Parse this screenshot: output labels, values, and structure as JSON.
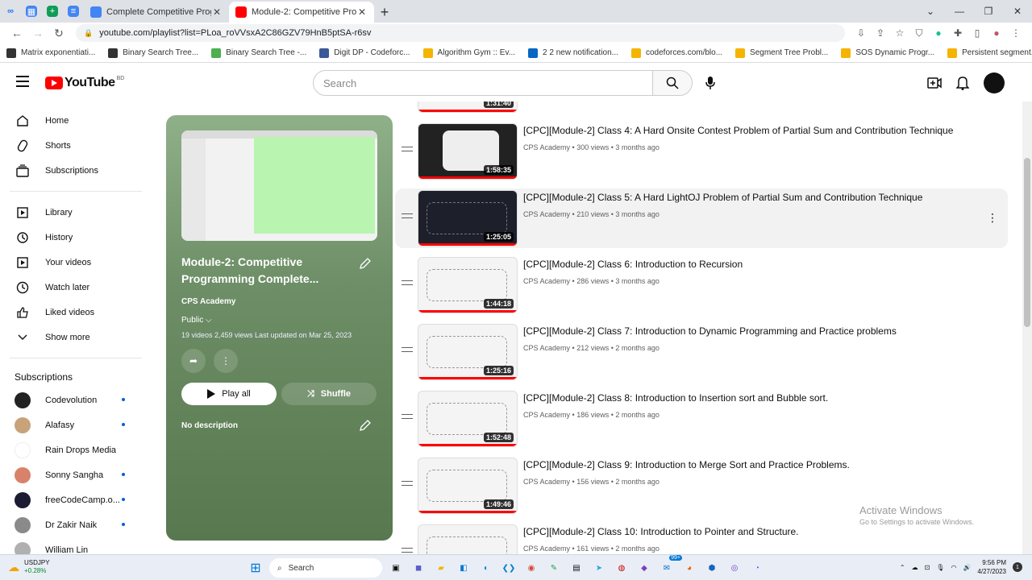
{
  "browser": {
    "tabs": [
      {
        "title": "Complete Competitive Programm",
        "active": false,
        "fav_color": "#4285f4"
      },
      {
        "title": "Module-2: Competitive Program",
        "active": true,
        "fav_color": "#ff0000"
      }
    ],
    "url": "youtube.com/playlist?list=PLoa_roVVsxA2C86GZV79HnB5ptSA-r6sv",
    "bookmarks": [
      "Matrix exponentiati...",
      "Binary Search Tree...",
      "Binary Search Tree -...",
      "Digit DP - Codeforc...",
      "Algorithm Gym :: Ev...",
      "2 2 new notification...",
      "codeforces.com/blo...",
      "Segment Tree Probl...",
      "SOS Dynamic Progr...",
      "Persistent segment..."
    ]
  },
  "youtube": {
    "logo_text": "YouTube",
    "region": "BD",
    "search_placeholder": "Search"
  },
  "sidebar": {
    "main": [
      {
        "label": "Home",
        "icon": "home-icon"
      },
      {
        "label": "Shorts",
        "icon": "shorts-icon"
      },
      {
        "label": "Subscriptions",
        "icon": "subscriptions-icon"
      }
    ],
    "library": [
      {
        "label": "Library",
        "icon": "library-icon"
      },
      {
        "label": "History",
        "icon": "history-icon"
      },
      {
        "label": "Your videos",
        "icon": "your-videos-icon"
      },
      {
        "label": "Watch later",
        "icon": "watch-later-icon"
      },
      {
        "label": "Liked videos",
        "icon": "liked-videos-icon"
      },
      {
        "label": "Show more",
        "icon": "chevron-down-icon"
      }
    ],
    "subscriptions_heading": "Subscriptions",
    "subscriptions": [
      {
        "name": "Codevolution",
        "color": "#222222",
        "dot": true
      },
      {
        "name": "Alafasy",
        "color": "#c8a27a",
        "dot": true
      },
      {
        "name": "Rain Drops Media",
        "color": "#ffffff",
        "dot": false
      },
      {
        "name": "Sonny Sangha",
        "color": "#d9826b",
        "dot": true
      },
      {
        "name": "freeCodeCamp.o...",
        "color": "#1b1b32",
        "dot": true
      },
      {
        "name": "Dr Zakir Naik",
        "color": "#8a8a8a",
        "dot": true
      },
      {
        "name": "William Lin",
        "color": "#b0b0b0",
        "dot": false
      }
    ]
  },
  "playlist": {
    "title": "Module-2: Competitive Programming Complete...",
    "channel": "CPS Academy",
    "visibility": "Public",
    "meta": "19 videos   2,459 views   Last updated on Mar 25, 2023",
    "play_all": "Play all",
    "shuffle": "Shuffle",
    "description": "No description"
  },
  "videos": [
    {
      "title": "",
      "meta": "",
      "duration": "1:31:40",
      "partial": true
    },
    {
      "title": "[CPC][Module-2] Class 4: A Hard Onsite Contest Problem of Partial Sum and Contribution Technique",
      "channel": "CPS Academy",
      "views": "300 views",
      "age": "3 months ago",
      "duration": "1:58:35"
    },
    {
      "title": "[CPC][Module-2] Class 5: A Hard LightOJ Problem of Partial Sum and Contribution Technique",
      "channel": "CPS Academy",
      "views": "210 views",
      "age": "3 months ago",
      "duration": "1:25:05",
      "hover": true
    },
    {
      "title": "[CPC][Module-2] Class 6: Introduction to Recursion",
      "channel": "CPS Academy",
      "views": "286 views",
      "age": "3 months ago",
      "duration": "1:44:18"
    },
    {
      "title": "[CPC][Module-2] Class 7: Introduction to Dynamic Programming and Practice problems",
      "channel": "CPS Academy",
      "views": "212 views",
      "age": "2 months ago",
      "duration": "1:25:16"
    },
    {
      "title": "[CPC][Module-2] Class 8: Introduction to Insertion sort and Bubble sort.",
      "channel": "CPS Academy",
      "views": "186 views",
      "age": "2 months ago",
      "duration": "1:52:48"
    },
    {
      "title": "[CPC][Module-2] Class 9: Introduction to Merge Sort and Practice Problems.",
      "channel": "CPS Academy",
      "views": "156 views",
      "age": "2 months ago",
      "duration": "1:49:46"
    },
    {
      "title": "[CPC][Module-2] Class 10: Introduction to Pointer and Structure.",
      "channel": "CPS Academy",
      "views": "161 views",
      "age": "2 months ago",
      "duration": ""
    }
  ],
  "watermark": {
    "line1": "Activate Windows",
    "line2": "Go to Settings to activate Windows."
  },
  "taskbar": {
    "ticker_symbol": "USDJPY",
    "ticker_change": "+0.28%",
    "search_label": "Search",
    "time": "9:56 PM",
    "date": "4/27/2023",
    "badge": "99+"
  }
}
